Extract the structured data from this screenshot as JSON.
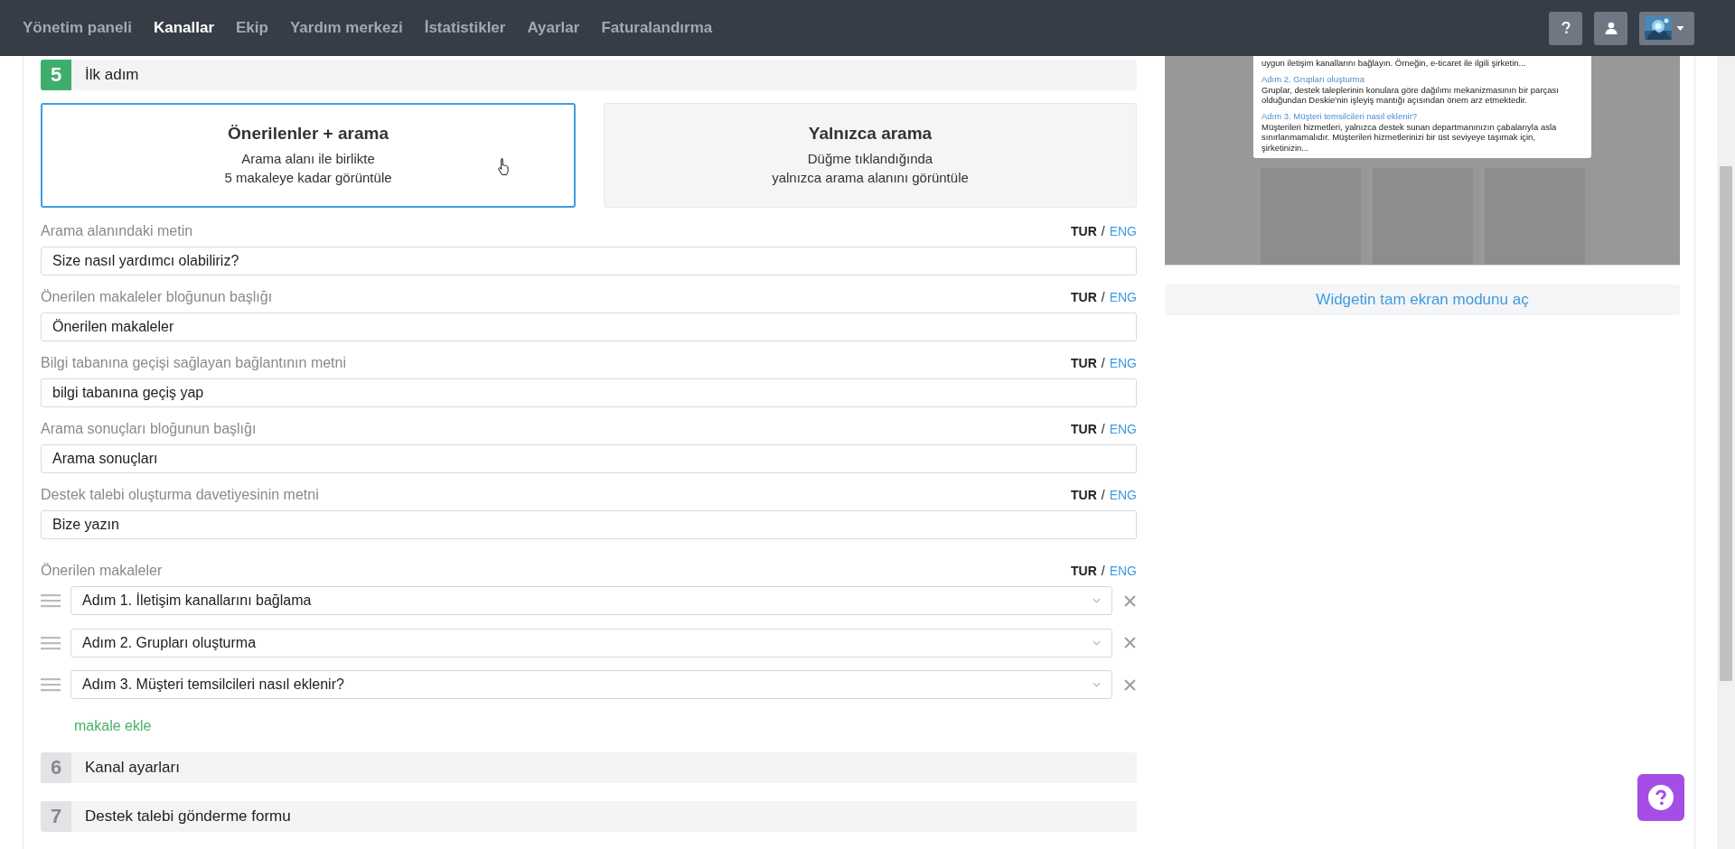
{
  "nav": {
    "items": [
      {
        "label": "Yönetim paneli",
        "selected": false
      },
      {
        "label": "Kanallar",
        "selected": true
      },
      {
        "label": "Ekip",
        "selected": false
      },
      {
        "label": "Yardım merkezi",
        "selected": false
      },
      {
        "label": "İstatistikler",
        "selected": false
      },
      {
        "label": "Ayarlar",
        "selected": false
      },
      {
        "label": "Faturalandırma",
        "selected": false
      }
    ]
  },
  "current_step": {
    "number": "5",
    "title": "İlk adım",
    "expanded": true
  },
  "display_modes": [
    {
      "title": "Önerilenler + arama",
      "lines": [
        "Arama alanı ile birlikte",
        "5 makaleye kadar görüntüle"
      ],
      "selected": true
    },
    {
      "title": "Yalnızca arama",
      "lines": [
        "Düğme tıklandığında",
        "yalnızca arama alanını görüntüle"
      ],
      "selected": false
    }
  ],
  "fields": [
    {
      "label": "Arama alanındaki metin",
      "value": "Size nasıl yardımcı olabiliriz?",
      "languages": [
        {
          "label": "TUR",
          "selected": true
        },
        {
          "label": "ENG",
          "selected": false
        }
      ],
      "separator": "/"
    },
    {
      "label": "Önerilen makaleler bloğunun başlığı",
      "value": "Önerilen makaleler",
      "languages": [
        {
          "label": "TUR",
          "selected": true
        },
        {
          "label": "ENG",
          "selected": false
        }
      ],
      "separator": "/"
    },
    {
      "label": "Bilgi tabanına geçişi sağlayan bağlantının metni",
      "value": "bilgi tabanına geçiş yap",
      "languages": [
        {
          "label": "TUR",
          "selected": true
        },
        {
          "label": "ENG",
          "selected": false
        }
      ],
      "separator": "/"
    },
    {
      "label": "Arama sonuçları bloğunun başlığı",
      "value": "Arama sonuçları",
      "languages": [
        {
          "label": "TUR",
          "selected": true
        },
        {
          "label": "ENG",
          "selected": false
        }
      ],
      "separator": "/"
    },
    {
      "label": "Destek talebi oluşturma davetiyesinin metni",
      "value": "Bize yazın",
      "languages": [
        {
          "label": "TUR",
          "selected": true
        },
        {
          "label": "ENG",
          "selected": false
        }
      ],
      "separator": "/"
    }
  ],
  "suggested_articles": {
    "label": "Önerilen makaleler",
    "languages": [
      {
        "label": "TUR",
        "selected": true
      },
      {
        "label": "ENG",
        "selected": false
      }
    ],
    "separator": "/",
    "items": [
      {
        "title": "Adım 1. İletişim kanallarını bağlama"
      },
      {
        "title": "Adım 2. Grupları oluşturma"
      },
      {
        "title": "Adım 3. Müşteri temsilcileri nasıl eklenir?"
      }
    ],
    "add_link": "makale ekle"
  },
  "other_steps": [
    {
      "number": "6",
      "title": "Kanal ayarları",
      "expanded": false
    },
    {
      "number": "7",
      "title": "Destek talebi gönderme formu",
      "expanded": false
    }
  ],
  "preview": {
    "articles": [
      {
        "excerpt": "uygun iletişim kanallarını bağlayın. Örneğin, e-ticaret ile ilgili şirketin..."
      },
      {
        "title": "Adım 2. Grupları oluşturma",
        "excerpt": "Gruplar, destek taleplerinin konulara göre dağılımı mekanizmasının bir parçası olduğundan Deskie'nin işleyiş mantığı açısından önem arz etmektedir."
      },
      {
        "title": "Adım 3. Müşteri temsilcileri nasıl eklenir?",
        "excerpt": "Müşterileri hizmetleri, yalnızca destek sunan departmanınızın çabalarıyla asla sınırlanmamalıdır. Müşterileri hizmetlerinizi bir üst seviyeye taşımak için, şirketinizin..."
      }
    ]
  },
  "fullscreen_button": "Widgetin tam ekran modunu aç"
}
